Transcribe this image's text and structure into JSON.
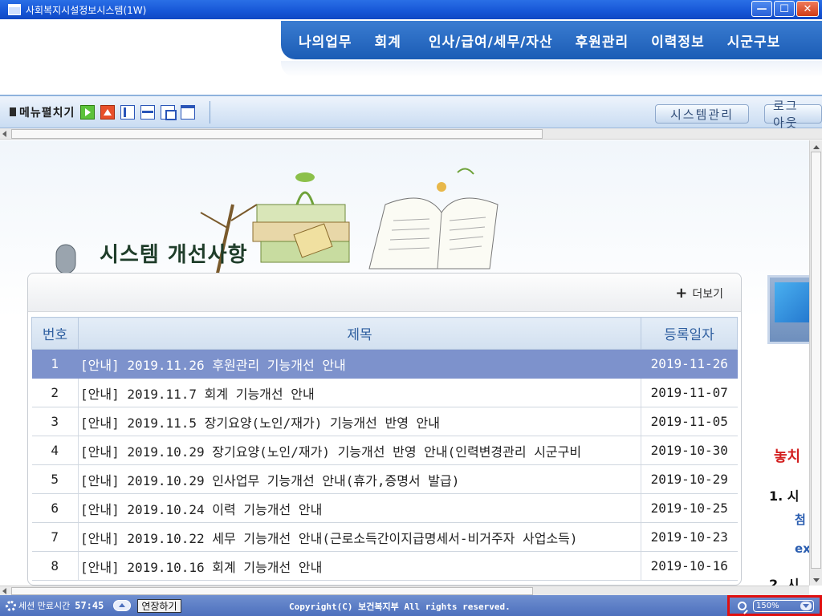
{
  "window": {
    "title": "사회복지시설정보시스템(1W)"
  },
  "topnav": {
    "items": [
      "나의업무",
      "회계",
      "인사/급여/세무/자산",
      "후원관리",
      "이력정보",
      "시군구보"
    ]
  },
  "toolbar": {
    "menu_label": "메뉴펼치기",
    "icons": [
      "expand-icon",
      "collapse-icon",
      "tile-vertical-icon",
      "tile-horizontal-icon",
      "cascade-icon",
      "maximize-icon"
    ],
    "system_button": "시스템관리",
    "logout_button": "로그아웃"
  },
  "section": {
    "title": "시스템 개선사항",
    "more_label": "더보기"
  },
  "table": {
    "headers": [
      "번호",
      "제목",
      "등록일자"
    ],
    "rows": [
      {
        "no": "1",
        "title": "[안내] 2019.11.26 후원관리 기능개선 안내",
        "date": "2019-11-26"
      },
      {
        "no": "2",
        "title": "[안내] 2019.11.7 회계 기능개선 안내",
        "date": "2019-11-07"
      },
      {
        "no": "3",
        "title": "[안내] 2019.11.5 장기요양(노인/재가) 기능개선 반영 안내",
        "date": "2019-11-05"
      },
      {
        "no": "4",
        "title": "[안내] 2019.10.29 장기요양(노인/재가) 기능개선 반영 안내(인력변경관리 시군구비",
        "date": "2019-10-30"
      },
      {
        "no": "5",
        "title": "[안내] 2019.10.29 인사업무 기능개선 안내(휴가,증명서 발급)",
        "date": "2019-10-29"
      },
      {
        "no": "6",
        "title": "[안내] 2019.10.24 이력 기능개선 안내",
        "date": "2019-10-25"
      },
      {
        "no": "7",
        "title": "[안내] 2019.10.22 세무 기능개선 안내(근로소득간이지급명세서-비거주자 사업소득)",
        "date": "2019-10-23"
      },
      {
        "no": "8",
        "title": "[안내] 2019.10.16 회계 기능개선 안내",
        "date": "2019-10-16"
      }
    ],
    "selected_row": 0
  },
  "side": {
    "red": "놓치",
    "item1": "1. 시",
    "blue1": "첨",
    "blue2": "ex",
    "item2": "2. 시"
  },
  "status": {
    "session_label": "세션 만료시간",
    "session_time": "57:45",
    "extend_button": "연장하기",
    "copyright": "Copyright(C) 보건복지부 All rights reserved.",
    "zoom": "150%"
  },
  "colors": {
    "nav": "#1b5cb5",
    "selected_row": "#7d92cc",
    "status": "#4d70bd",
    "highlight_box": "#e01010"
  }
}
